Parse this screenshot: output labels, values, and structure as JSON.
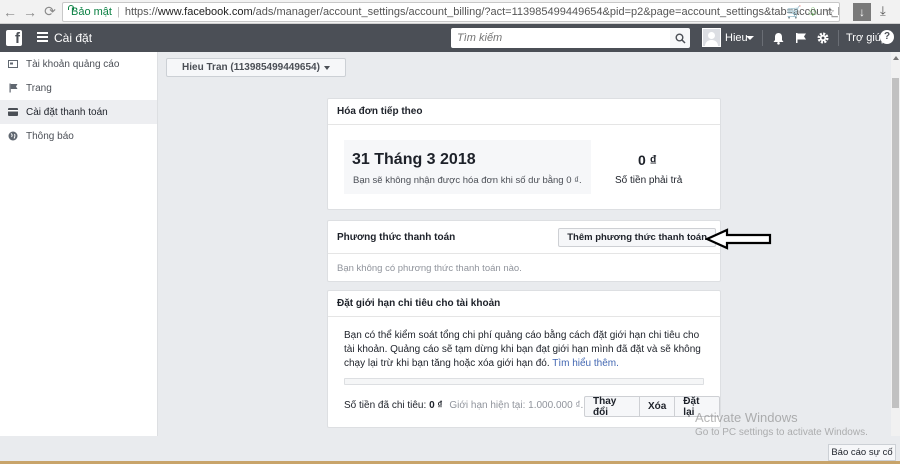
{
  "browser": {
    "secure_label": "Bảo mật",
    "url_scheme": "https://",
    "url_host": "www.facebook.com",
    "url_path": "/ads/manager/account_settings/account_billing/?act=113985499449654&pid=p2&page=account_settings&tab=account_billing_settings"
  },
  "topbar": {
    "title": "Cài đặt",
    "search_placeholder": "Tìm kiếm",
    "user_name": "Hieu",
    "help_label": "Trợ giúp"
  },
  "sidebar": {
    "items": [
      {
        "label": "Tài khoản quảng cáo",
        "icon": "ad-account-icon"
      },
      {
        "label": "Trang",
        "icon": "flag-icon"
      },
      {
        "label": "Cài đặt thanh toán",
        "icon": "credit-card-icon"
      },
      {
        "label": "Thông báo",
        "icon": "globe-icon"
      }
    ],
    "active_index": 2
  },
  "account_selector": {
    "value": "Hieu Tran (113985499449654)"
  },
  "next_bill": {
    "heading": "Hóa đơn tiếp theo",
    "date": "31 Tháng 3 2018",
    "note": "Bạn sẽ không nhận được hóa đơn khi số dư bằng 0 ₫.",
    "amount": "0 ₫",
    "amount_label": "Số tiền phải trả"
  },
  "payment_methods": {
    "heading": "Phương thức thanh toán",
    "add_button": "Thêm phương thức thanh toán",
    "empty_text": "Bạn không có phương thức thanh toán nào."
  },
  "spending_limit": {
    "heading": "Đặt giới hạn chi tiêu cho tài khoản",
    "description": "Bạn có thể kiểm soát tổng chi phí quảng cáo bằng cách đặt giới hạn chi tiêu cho tài khoản. Quảng cáo sẽ tạm dừng khi bạn đạt giới hạn mình đã đặt và sẽ không chạy lại trừ khi bạn tăng hoặc xóa giới hạn đó.",
    "learn_more": "Tìm hiểu thêm.",
    "progress_fraction": 0,
    "spent_label": "Số tiền đã chi tiêu:",
    "spent_value": "0 ₫",
    "current_limit": "Giới hạn hiện tại: 1.000.000 ₫.",
    "change_button": "Thay đổi",
    "remove_button": "Xóa",
    "reset_button": "Đặt lại"
  },
  "watermark": {
    "line1": "Activate Windows",
    "line2": "Go to PC settings to activate Windows."
  },
  "report_button": "Báo cáo sự cố"
}
